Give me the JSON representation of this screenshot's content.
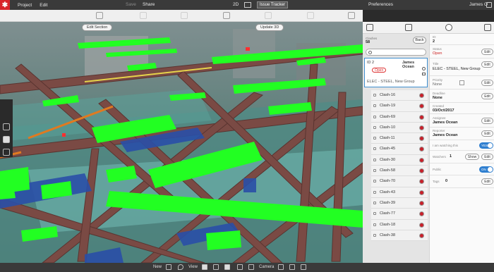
{
  "menubar": {
    "logo": "✱",
    "project": "Project",
    "edit": "Edit",
    "save": "Save",
    "share": "Share",
    "view_2d": "2D",
    "issue_tracker": "Issue Tracker",
    "preferences": "Preferences",
    "user": "James O"
  },
  "viewport": {
    "edit_section": "Edit Section",
    "update_3d": "Update 3D"
  },
  "clashes": {
    "header_label": "Clashes",
    "count": "58",
    "back": "Back",
    "search_placeholder": "",
    "selected": {
      "id": "ID 2",
      "assignee": "James Ocean",
      "status": "Open",
      "title": "ELEC - STEEL, New Group"
    },
    "items": [
      "Clash-16",
      "Clash-19",
      "Clash-69",
      "Clash-10",
      "Clash-11",
      "Clash-45",
      "Clash-30",
      "Clash-58",
      "Clash-70",
      "Clash-43",
      "Clash-39",
      "Clash-77",
      "Clash-18",
      "Clash-38"
    ]
  },
  "details": {
    "id_label": "ID",
    "id_value": "2",
    "status_label": "Status",
    "status_value": "Open",
    "title_label": "Title",
    "title_value": "ELEC - STEEL, New Group",
    "priority_label": "Priority",
    "priority_value": "None",
    "deadline_label": "Deadline",
    "deadline_value": "None",
    "created_label": "Created",
    "created_value": "03/Oct/2017",
    "assignee_label": "Assignee",
    "assignee_value": "James Ocean",
    "reporter_label": "Reporter",
    "reporter_value": "James Ocean",
    "watching_label": "I am watching this",
    "watching_toggle": "YES",
    "watchers_label": "Watchers",
    "watchers_value": "1",
    "public_label": "Public",
    "public_toggle": "ON",
    "tags_label": "Tags",
    "tags_value": "0",
    "edit": "Edit",
    "show": "Show"
  },
  "bottombar": {
    "new": "New",
    "view": "View",
    "camera": "Camera"
  },
  "colors": {
    "accent_blue": "#2f7fd0",
    "status_red": "#cc2020",
    "logo_red": "#d8242a",
    "model_green": "#22ff22",
    "steel_brown": "#7a4a44"
  }
}
